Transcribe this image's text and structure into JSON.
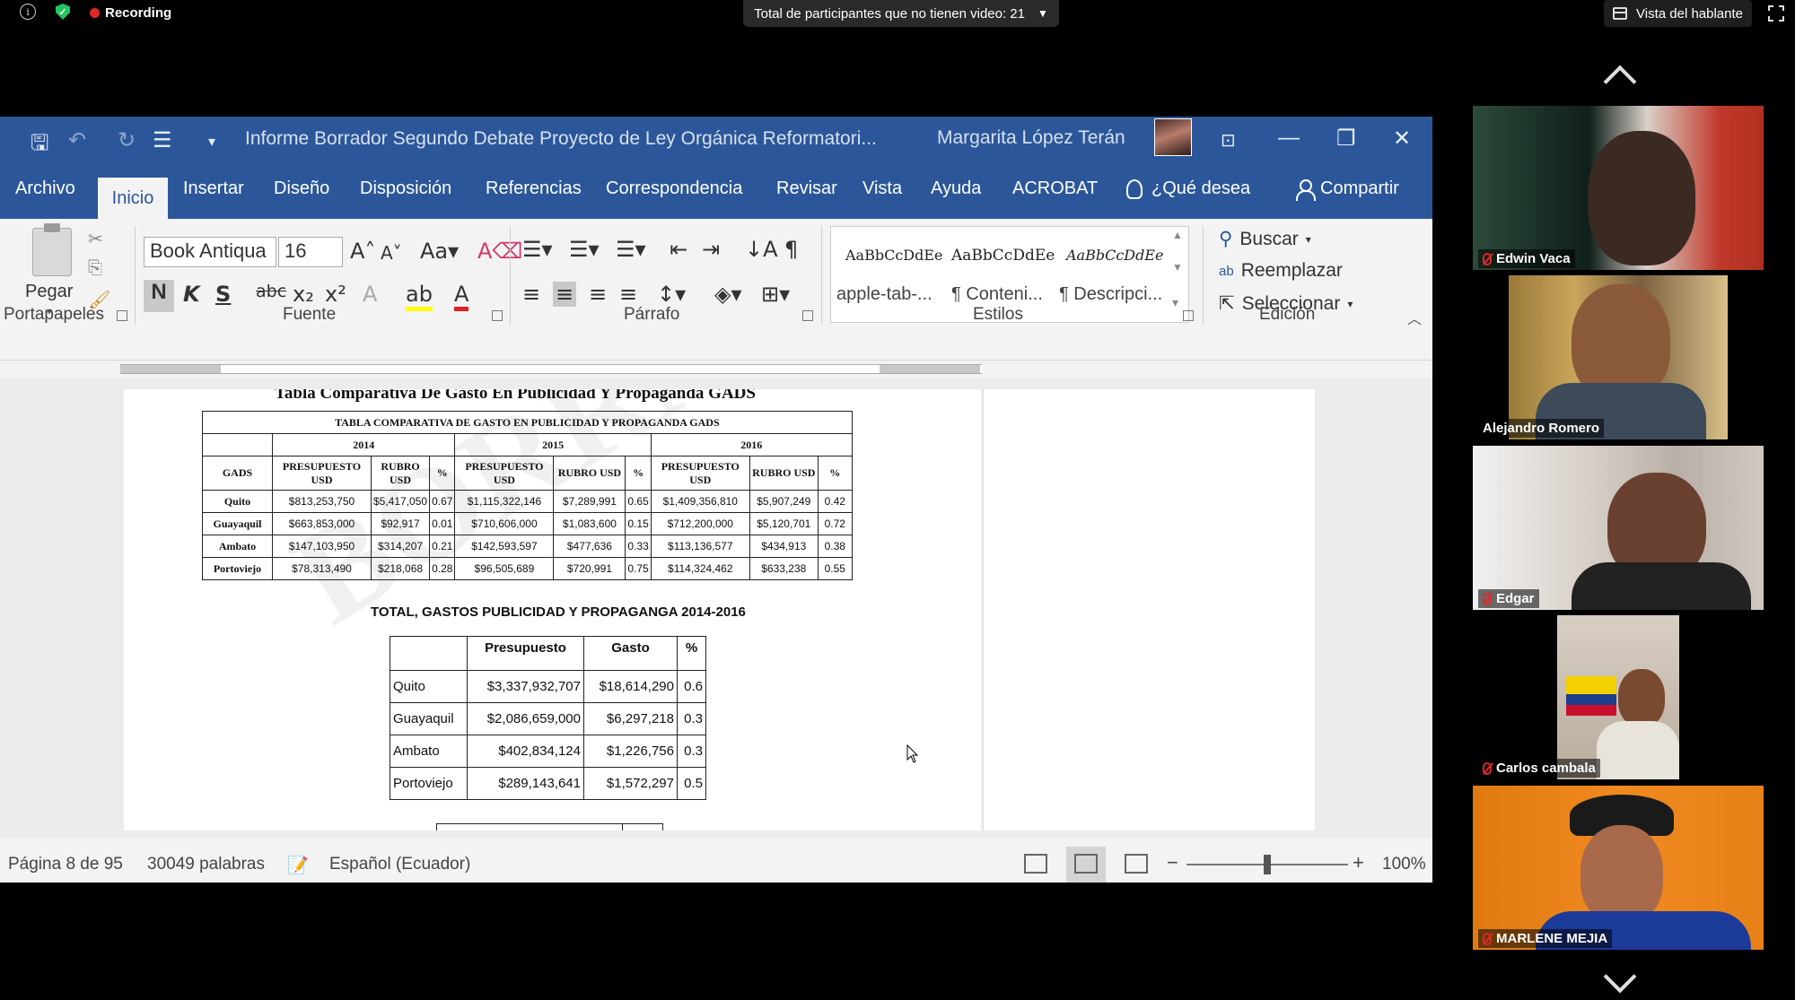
{
  "zoom": {
    "recording_label": "Recording",
    "participants_banner": "Total de participantes que no tienen video: 21",
    "speaker_view": "Vista del hablante",
    "participants": [
      {
        "name": "Edwin Vaca",
        "muted": true
      },
      {
        "name": "Alejandro Romero",
        "muted": false
      },
      {
        "name": "Edgar",
        "muted": true
      },
      {
        "name": "Carlos cambala",
        "muted": true
      },
      {
        "name": "MARLENE MEJIA",
        "muted": true
      }
    ]
  },
  "word": {
    "doc_title": "Informe Borrador Segundo Debate Proyecto de Ley Orgánica Reformatori...",
    "user_name": "Margarita López Terán",
    "tabs": [
      "Archivo",
      "Inicio",
      "Insertar",
      "Diseño",
      "Disposición",
      "Referencias",
      "Correspondencia",
      "Revisar",
      "Vista",
      "Ayuda",
      "ACROBAT"
    ],
    "active_tab": "Inicio",
    "tell_me": "¿Qué desea",
    "share": "Compartir",
    "ribbon": {
      "clipboard_label": "Portapapeles",
      "paste_label": "Pegar",
      "font_group_label": "Fuente",
      "font_name": "Book Antiqua",
      "font_size": "16",
      "paragraph_label": "Párrafo",
      "styles_label": "Estilos",
      "editing_label": "Edición",
      "styles": [
        {
          "sample": "AaBbCcDdEe",
          "name": "apple-tab-..."
        },
        {
          "sample": "AaBbCcDdEe",
          "name": "¶ Conteni..."
        },
        {
          "sample": "AaBbCcDdEe",
          "name": "¶ Descripci..."
        }
      ],
      "find": "Buscar",
      "replace": "Reemplazar",
      "select": "Seleccionar"
    },
    "status": {
      "page": "Página 8 de 95",
      "words": "30049 palabras",
      "language": "Español (Ecuador)",
      "zoom": "100%"
    }
  },
  "document": {
    "watermark": "BORRADOR",
    "heading": "Tabla Comparativa De Gasto En Publicidad Y Propaganda GADS",
    "table1": {
      "title": "TABLA COMPARATIVA DE GASTO EN PUBLICIDAD Y PROPAGANDA GADS",
      "years": [
        "2014",
        "2015",
        "2016"
      ],
      "col_gads": "GADS",
      "col_budget": "PRESUPUESTO USD",
      "col_spend": "RUBRO USD",
      "col_spend_2015": "RUBRO USD",
      "col_pct": "%",
      "rows": [
        {
          "city": "Quito",
          "v": [
            "$813,253,750",
            "$5,417,050",
            "0.67",
            "$1,115,322,146",
            "$7,289,991",
            "0.65",
            "$1,409,356,810",
            "$5,907,249",
            "0.42"
          ]
        },
        {
          "city": "Guayaquil",
          "v": [
            "$663,853,000",
            "$92,917",
            "0.01",
            "$710,606,000",
            "$1,083,600",
            "0.15",
            "$712,200,000",
            "$5,120,701",
            "0.72"
          ]
        },
        {
          "city": "Ambato",
          "v": [
            "$147,103,950",
            "$314,207",
            "0.21",
            "$142,593,597",
            "$477,636",
            "0.33",
            "$113,136,577",
            "$434,913",
            "0.38"
          ]
        },
        {
          "city": "Portoviejo",
          "v": [
            "$78,313,490",
            "$218,068",
            "0.28",
            "$96,505,689",
            "$720,991",
            "0.75",
            "$114,324,462",
            "$633,238",
            "0.55"
          ]
        }
      ]
    },
    "table2": {
      "title": "TOTAL, GASTOS PUBLICIDAD Y PROPAGANGA 2014-2016",
      "headers": [
        "",
        "Presupuesto",
        "Gasto",
        "%"
      ],
      "rows": [
        [
          "Quito",
          "$3,337,932,707",
          "$18,614,290",
          "0.6"
        ],
        [
          "Guayaquil",
          "$2,086,659,000",
          "$6,297,218",
          "0.3"
        ],
        [
          "Ambato",
          "$402,834,124",
          "$1,226,756",
          "0.3"
        ],
        [
          "Portoviejo",
          "$289,143,641",
          "$1,572,297",
          "0.5"
        ]
      ]
    }
  }
}
